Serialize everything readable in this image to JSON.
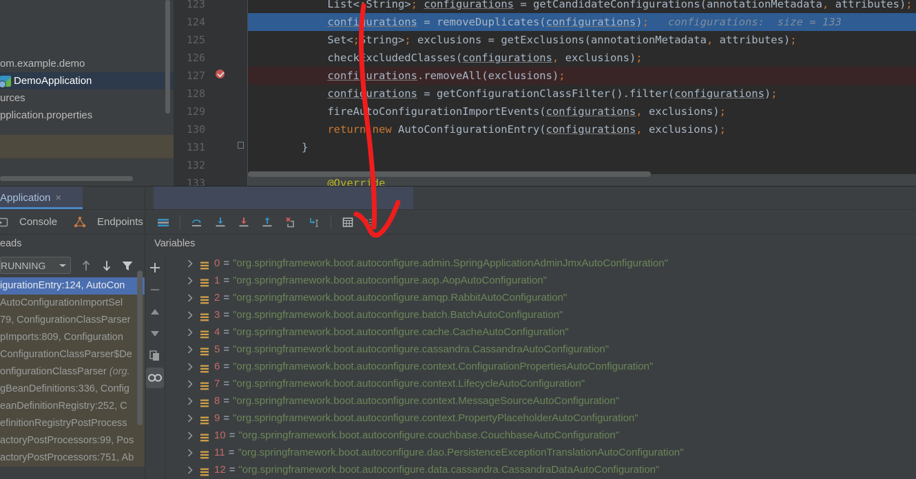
{
  "project": {
    "items": [
      {
        "label": "om.example.demo",
        "icon": "package-icon",
        "selected": false,
        "has_icon": false
      },
      {
        "label": "DemoApplication",
        "icon": "java-class-run-icon",
        "selected": true,
        "has_icon": true
      },
      {
        "label": "urces",
        "icon": "folder-icon",
        "selected": false,
        "has_icon": false
      },
      {
        "label": "pplication.properties",
        "icon": "properties-file-icon",
        "selected": false,
        "has_icon": false
      }
    ]
  },
  "editor": {
    "lines": [
      {
        "num": "123",
        "state": "normal",
        "text": "    List<String> configurations = getCandidateConfigurations(annotationMetadata, attributes);"
      },
      {
        "num": "124",
        "state": "highlight",
        "text": "    configurations = removeDuplicates(configurations);",
        "inlay": "configurations:  size = 133"
      },
      {
        "num": "125",
        "state": "normal",
        "text": "    Set<String> exclusions = getExclusions(annotationMetadata, attributes);"
      },
      {
        "num": "126",
        "state": "normal",
        "text": "    checkExcludedClasses(configurations, exclusions);"
      },
      {
        "num": "127",
        "state": "breakpoint",
        "text": "    configurations.removeAll(exclusions);"
      },
      {
        "num": "128",
        "state": "normal",
        "text": "    configurations = getConfigurationClassFilter().filter(configurations);"
      },
      {
        "num": "129",
        "state": "normal",
        "text": "    fireAutoConfigurationImportEvents(configurations, exclusions);"
      },
      {
        "num": "130",
        "state": "normal",
        "text": "    return new AutoConfigurationEntry(configurations, exclusions);"
      },
      {
        "num": "131",
        "state": "normal",
        "text": "}"
      },
      {
        "num": "132",
        "state": "normal",
        "text": ""
      },
      {
        "num": "133",
        "state": "folded",
        "text": "    @Override"
      }
    ],
    "colors": {
      "background": "#2b2b2b",
      "gutter": "#313335",
      "selection": "#2e5c93",
      "breakpoint_line": "#3a2526",
      "breakpoint_marker": "#c75450",
      "text": "#a9b7c6",
      "keyword": "#cc7832",
      "annotation": "#bbb529",
      "inlay_hint": "#7d8e9e"
    }
  },
  "debug": {
    "tab": {
      "label": "Application",
      "close": "×"
    },
    "toolbar": {
      "console_label": "Console",
      "endpoints_label": "Endpoints",
      "icons": [
        {
          "name": "console-icon"
        },
        {
          "name": "endpoints-icon"
        },
        {
          "name": "frames-layout-icon"
        },
        {
          "name": "step-over-icon"
        },
        {
          "name": "step-into-icon"
        },
        {
          "name": "force-step-into-icon"
        },
        {
          "name": "step-out-icon"
        },
        {
          "name": "drop-frame-icon"
        },
        {
          "name": "run-to-cursor-icon"
        },
        {
          "name": "evaluate-expression-icon"
        },
        {
          "name": "hide-frames-icon"
        }
      ]
    },
    "panes": {
      "threads_title": "eads",
      "variables_title": "Variables"
    },
    "frames": {
      "thread_state": "RUNNING",
      "toolbar_icons": [
        {
          "name": "frame-up-icon"
        },
        {
          "name": "frame-down-icon"
        },
        {
          "name": "filter-frames-icon"
        }
      ],
      "rows": [
        {
          "text": "igurationEntry:124, AutoCon",
          "selected": true
        },
        {
          "text": "AutoConfigurationImportSel",
          "selected": false
        },
        {
          "text": "79, ConfigurationClassParser",
          "selected": false
        },
        {
          "text": "pImports:809, Configuration",
          "selected": false
        },
        {
          "text": "ConfigurationClassParser$De",
          "selected": false
        },
        {
          "text": "onfigurationClassParser (org.",
          "selected": false,
          "italic_tail": true
        },
        {
          "text": "gBeanDefinitions:336, Config",
          "selected": false
        },
        {
          "text": "eanDefinitionRegistry:252, C",
          "selected": false
        },
        {
          "text": "efinitionRegistryPostProcess",
          "selected": false
        },
        {
          "text": "actoryPostProcessors:99, Pos",
          "selected": false
        },
        {
          "text": "actoryPostProcessors:751, Ab",
          "selected": false
        }
      ]
    },
    "mini_toolbar": [
      {
        "name": "add-watch-icon",
        "glyph": "+",
        "active": false
      },
      {
        "name": "remove-watch-icon",
        "glyph": "−",
        "active": false
      },
      {
        "name": "move-watch-up-icon",
        "glyph": "▲",
        "active": false
      },
      {
        "name": "move-watch-down-icon",
        "glyph": "▼",
        "active": false
      },
      {
        "name": "copy-value-icon",
        "glyph": "❐",
        "active": false
      },
      {
        "name": "show-watches-icon",
        "glyph": "oo",
        "active": true
      }
    ],
    "variables": [
      {
        "index": "0",
        "value": "\"org.springframework.boot.autoconfigure.admin.SpringApplicationAdminJmxAutoConfiguration\""
      },
      {
        "index": "1",
        "value": "\"org.springframework.boot.autoconfigure.aop.AopAutoConfiguration\""
      },
      {
        "index": "2",
        "value": "\"org.springframework.boot.autoconfigure.amqp.RabbitAutoConfiguration\""
      },
      {
        "index": "3",
        "value": "\"org.springframework.boot.autoconfigure.batch.BatchAutoConfiguration\""
      },
      {
        "index": "4",
        "value": "\"org.springframework.boot.autoconfigure.cache.CacheAutoConfiguration\""
      },
      {
        "index": "5",
        "value": "\"org.springframework.boot.autoconfigure.cassandra.CassandraAutoConfiguration\""
      },
      {
        "index": "6",
        "value": "\"org.springframework.boot.autoconfigure.context.ConfigurationPropertiesAutoConfiguration\""
      },
      {
        "index": "7",
        "value": "\"org.springframework.boot.autoconfigure.context.LifecycleAutoConfiguration\""
      },
      {
        "index": "8",
        "value": "\"org.springframework.boot.autoconfigure.context.MessageSourceAutoConfiguration\""
      },
      {
        "index": "9",
        "value": "\"org.springframework.boot.autoconfigure.context.PropertyPlaceholderAutoConfiguration\""
      },
      {
        "index": "10",
        "value": "\"org.springframework.boot.autoconfigure.couchbase.CouchbaseAutoConfiguration\""
      },
      {
        "index": "11",
        "value": "\"org.springframework.boot.autoconfigure.dao.PersistenceExceptionTranslationAutoConfiguration\""
      },
      {
        "index": "12",
        "value": "\"org.springframework.boot.autoconfigure.data.cassandra.CassandraDataAutoConfiguration\""
      }
    ],
    "colors": {
      "panel": "#3c3f41",
      "tab_active": "#41485a",
      "tab_underline": "#4a88c7",
      "frame_selected": "#4b6eaf",
      "frame_band": "#4e4a3e",
      "index": "#c4696a",
      "string": "#6a8759"
    }
  },
  "annotation": {
    "name": "red-arrow",
    "color": "#f01d1d"
  }
}
